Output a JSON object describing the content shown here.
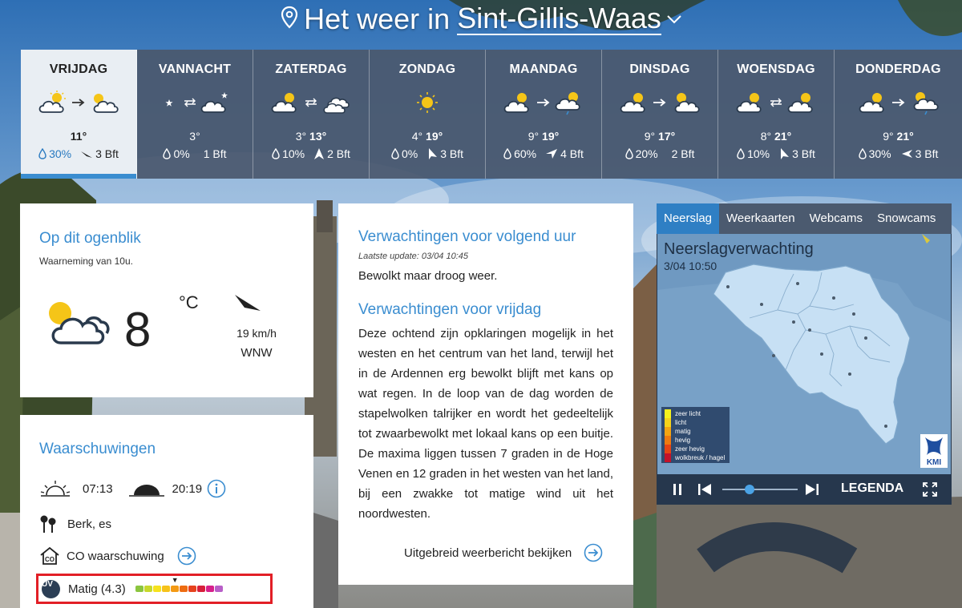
{
  "header": {
    "title_prefix": "Het weer in",
    "city": "Sint-Gillis-Waas"
  },
  "days": [
    {
      "name": "VRIJDAG",
      "min": "",
      "max": "11°",
      "rain": "30%",
      "wind": "3 Bft",
      "active": true
    },
    {
      "name": "VANNACHT",
      "min": "3°",
      "max": "",
      "rain": "0%",
      "wind": "1 Bft"
    },
    {
      "name": "ZATERDAG",
      "min": "3°",
      "max": "13°",
      "rain": "10%",
      "wind": "2 Bft"
    },
    {
      "name": "ZONDAG",
      "min": "4°",
      "max": "19°",
      "rain": "0%",
      "wind": "3 Bft"
    },
    {
      "name": "MAANDAG",
      "min": "9°",
      "max": "19°",
      "rain": "60%",
      "wind": "4 Bft"
    },
    {
      "name": "DINSDAG",
      "min": "9°",
      "max": "17°",
      "rain": "20%",
      "wind": "2 Bft"
    },
    {
      "name": "WOENSDAG",
      "min": "8°",
      "max": "21°",
      "rain": "10%",
      "wind": "3 Bft"
    },
    {
      "name": "DONDERDAG",
      "min": "9°",
      "max": "21°",
      "rain": "30%",
      "wind": "3 Bft"
    }
  ],
  "current": {
    "title": "Op dit ogenblik",
    "observation": "Waarneming van 10u.",
    "temperature": "8",
    "unit": "°C",
    "wind_speed": "19 km/h",
    "wind_direction": "WNW"
  },
  "warnings": {
    "title": "Waarschuwingen",
    "sunrise": "07:13",
    "sunset": "20:19",
    "pollen": "Berk, es",
    "co": "CO waarschuwing",
    "uv_badge": "UV",
    "uv_text": "Matig (4.3)",
    "uv_marker": "▼",
    "uv_level": 4.3
  },
  "forecast": {
    "next_hour_title": "Verwachtingen voor volgend uur",
    "updated": "Laatste update: 03/04 10:45",
    "next_hour_text": "Bewolkt maar droog weer.",
    "day_title": "Verwachtingen voor vrijdag",
    "day_text": "Deze ochtend zijn opklaringen mogelijk in het westen en het centrum van het land, terwijl het in de Ardennen erg bewolkt blijft met kans op wat regen. In de loop van de dag worden de stapelwolken talrijker en wordt het gedeeltelijk tot zwaarbewolkt met lokaal kans op een buitje. De maxima liggen tussen 7 graden in de Hoge Venen en 12 graden in het westen van het land, bij een zwakke tot matige wind uit het noordwesten.",
    "more_link": "Uitgebreid weerbericht bekijken"
  },
  "radar": {
    "tabs": [
      "Neerslag",
      "Weerkaarten",
      "Webcams",
      "Snowcams"
    ],
    "title": "Neerslagverwachting",
    "time": "3/04 10:50",
    "legend": [
      "zeer licht",
      "licht",
      "matig",
      "hevig",
      "zeer hevig",
      "wolkbreuk / hagel"
    ],
    "legend_colors": [
      "#f6f21d",
      "#f6d31a",
      "#f3a512",
      "#ee7a10",
      "#e64414",
      "#c4122a"
    ],
    "logo": "KMI",
    "legend_button": "LEGENDA"
  },
  "colors": {
    "accent": "#3a8dd0",
    "highlight_box": "#e21f26",
    "tile_background": "#4a586e"
  }
}
